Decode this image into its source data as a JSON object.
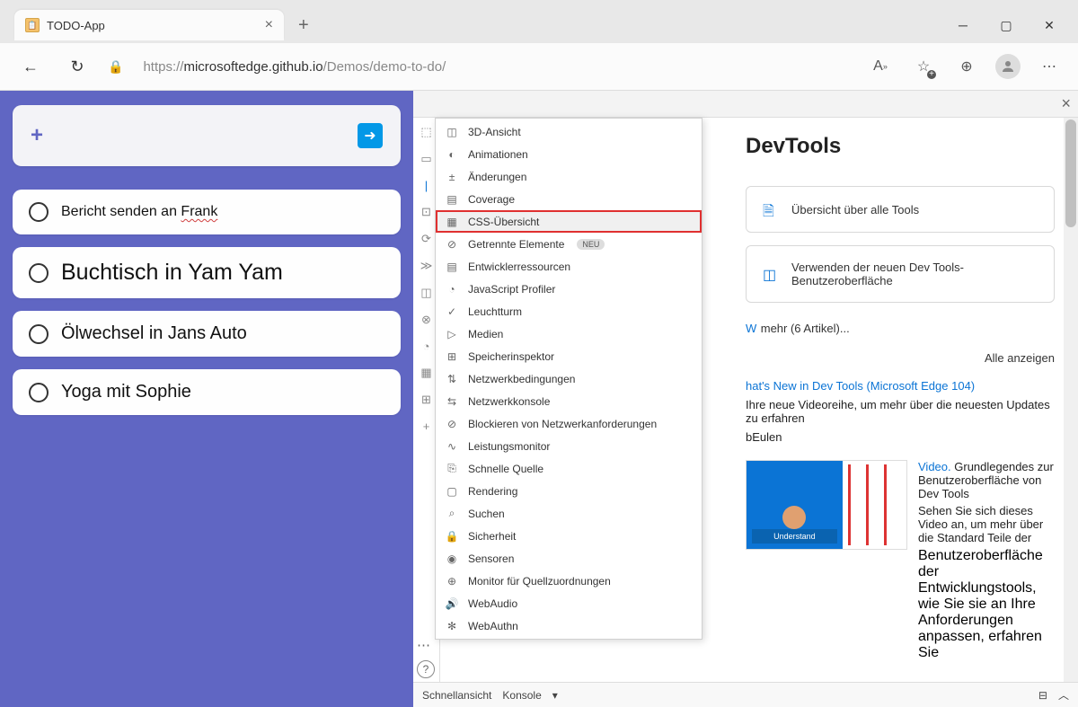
{
  "browser": {
    "tab_title": "TODO-App",
    "url": {
      "prefix": "https://",
      "host": "microsoftedge.github.io",
      "path": "/Demos/demo-to-do/"
    }
  },
  "todo": {
    "items": [
      {
        "text_prefix": "Bericht senden an ",
        "text_suffix": "Frank",
        "size": "small",
        "wavy_suffix": true
      },
      {
        "text_prefix": "Buchtisch in Yam Yam",
        "text_suffix": "",
        "size": "large",
        "wavy_suffix": false
      },
      {
        "text_prefix": "Ölwechsel in Jans Auto",
        "text_suffix": "",
        "size": "normal",
        "wavy_suffix": false
      },
      {
        "text_prefix": "Yoga mit Sophie",
        "text_suffix": "",
        "size": "normal",
        "wavy_suffix": false
      }
    ]
  },
  "menu": {
    "items": [
      {
        "label": "3D-Ansicht",
        "icon": "◫"
      },
      {
        "label": "Animationen",
        "icon": "◐"
      },
      {
        "label": "Änderungen",
        "icon": "±"
      },
      {
        "label": "Coverage",
        "icon": "▤"
      },
      {
        "label": "CSS-Übersicht",
        "icon": "▦",
        "highlighted": true
      },
      {
        "label": "Getrennte Elemente",
        "icon": "⊘",
        "badge": "NEU"
      },
      {
        "label": "Entwicklerressourcen",
        "icon": "▤"
      },
      {
        "label": "JavaScript Profiler",
        "icon": "◔"
      },
      {
        "label": "Leuchtturm",
        "icon": "✓"
      },
      {
        "label": "Medien",
        "icon": "▷"
      },
      {
        "label": "Speicherinspektor",
        "icon": "⊞"
      },
      {
        "label": "Netzwerkbedingungen",
        "icon": "⇅"
      },
      {
        "label": "Netzwerkkonsole",
        "icon": "⇆"
      },
      {
        "label": "Blockieren von Netzwerkanforderungen",
        "icon": "⊘"
      },
      {
        "label": "Leistungsmonitor",
        "icon": "∿"
      },
      {
        "label": "Schnelle Quelle",
        "icon": "⎘"
      },
      {
        "label": "Rendering",
        "icon": "▢"
      },
      {
        "label": "Suchen",
        "icon": "⌕"
      },
      {
        "label": "Sicherheit",
        "icon": "🔒"
      },
      {
        "label": "Sensoren",
        "icon": "◉"
      },
      {
        "label": "Monitor für Quellzuordnungen",
        "icon": "⊕"
      },
      {
        "label": "WebAudio",
        "icon": "🔊"
      },
      {
        "label": "WebAuthn",
        "icon": "✻"
      }
    ]
  },
  "welcome": {
    "title": "DevTools",
    "card1": "Übersicht über alle Tools",
    "card2": "Verwenden der neuen Dev Tools-Benutzeroberfläche",
    "more_link_prefix": "W",
    "more_link_text": "mehr (6 Artikel)...",
    "show_all": "Alle anzeigen",
    "article1_title": "hat's New in Dev Tools (Microsoft Edge 104)",
    "article1_line1": "Ihre neue Videoreihe, um mehr über die neuesten Updates zu erfahren",
    "article1_line2": "bEulen",
    "video_tag": "Video. ",
    "video_title": "Grundlegendes zur Benutzeroberfläche von Dev Tools",
    "video_sub": "Sehen Sie sich dieses Video an, um mehr über die Standard Teile der",
    "video_grey": "Benutzeroberfläche der Entwicklungstools, wie Sie sie an Ihre Anforderungen anpassen, erfahren Sie",
    "thumb_label": "Understand"
  },
  "footer": {
    "quickview": "Schnellansicht",
    "console": "Konsole"
  }
}
